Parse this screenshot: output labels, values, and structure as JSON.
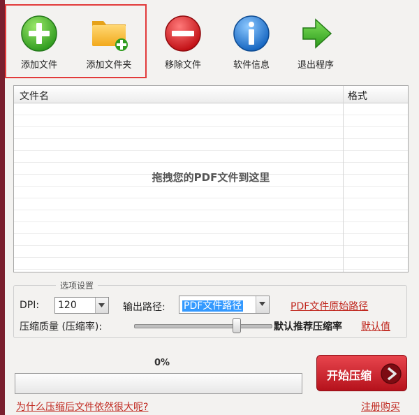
{
  "toolbar": {
    "add_file": "添加文件",
    "add_folder": "添加文件夹",
    "remove_file": "移除文件",
    "software_info": "软件信息",
    "exit_program": "退出程序"
  },
  "file_list": {
    "columns": [
      "文件名",
      "格式"
    ],
    "drop_hint": "拖拽您的PDF文件到这里"
  },
  "options": {
    "legend": "选项设置",
    "dpi_label": "DPI:",
    "dpi_value": "120",
    "output_path_label": "输出路径:",
    "output_path_value": "PDF文件路径",
    "original_path_link": "PDF文件原始路径",
    "quality_label": "压缩质量 (压缩率):",
    "quality_value_fraction": 0.75,
    "recommended_text": "默认推荐压缩率",
    "default_link": "默认值"
  },
  "progress": {
    "percent_text": "0%",
    "value_fraction": 0
  },
  "actions": {
    "start_label": "开始压缩",
    "why_large_link": "为什么压缩后文件依然很大呢?",
    "register_link": "注册购买"
  },
  "colors": {
    "accent_red": "#c0281f",
    "highlight_border": "#e23a3a",
    "background": "#f3f2f0"
  },
  "icons": {
    "add_file": "plus-circle-icon",
    "add_folder": "folder-plus-icon",
    "remove_file": "minus-circle-icon",
    "software_info": "info-circle-icon",
    "exit_program": "arrow-right-icon",
    "start": "chevron-right-circle-icon"
  }
}
